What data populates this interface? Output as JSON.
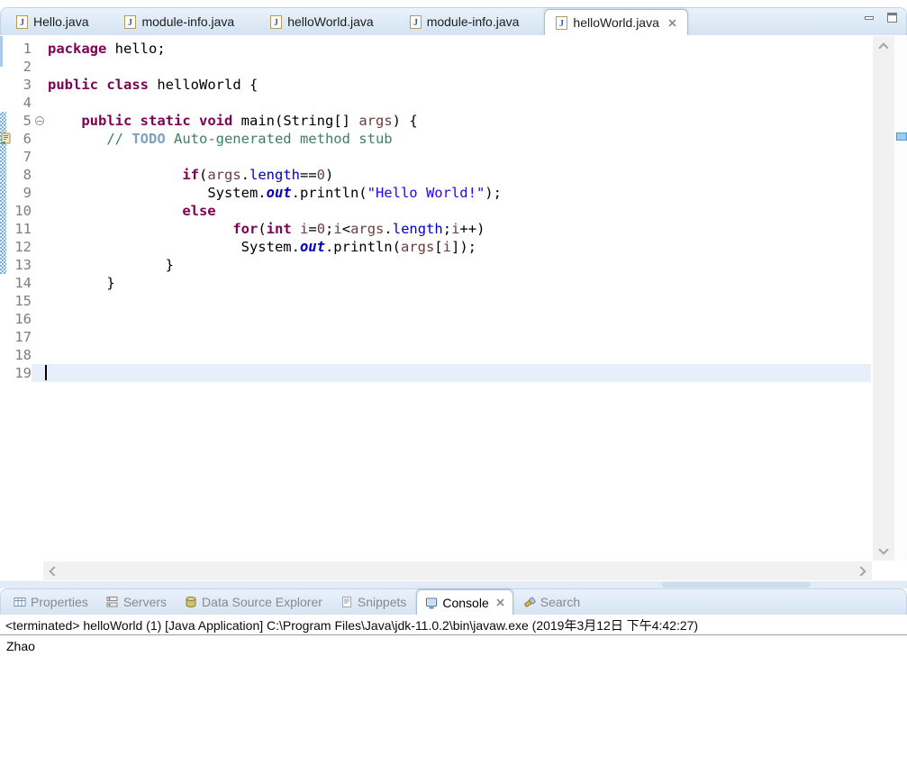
{
  "colors": {
    "keyword": "#7F0055",
    "string": "#2A00FF",
    "comment": "#3F7F5F",
    "task_tag": "#7F9FBF",
    "field": "#0000C0",
    "static_field": "#0000C0",
    "variable": "#6A3E3E",
    "line_number": "#7E7E7E",
    "current_line_bg": "#E7F0FA",
    "tab_bar_bg": "#D9E7F5"
  },
  "editor_tabs": [
    {
      "label": "Hello.java",
      "icon": "java-file",
      "active": false
    },
    {
      "label": "module-info.java",
      "icon": "java-file",
      "active": false
    },
    {
      "label": "helloWorld.java",
      "icon": "java-file",
      "active": false
    },
    {
      "label": "module-info.java",
      "icon": "java-file",
      "active": false
    },
    {
      "label": "helloWorld.java",
      "icon": "java-file",
      "active": true,
      "closable": true
    }
  ],
  "code": {
    "lines": [
      {
        "n": 1,
        "seg": [
          [
            "kw",
            "package"
          ],
          [
            "pl",
            " hello;"
          ]
        ]
      },
      {
        "n": 2,
        "seg": []
      },
      {
        "n": 3,
        "seg": [
          [
            "kw",
            "public"
          ],
          [
            "pl",
            " "
          ],
          [
            "kw",
            "class"
          ],
          [
            "pl",
            " helloWorld {"
          ]
        ]
      },
      {
        "n": 4,
        "seg": []
      },
      {
        "n": 5,
        "diff": true,
        "fold": "collapse",
        "seg": [
          [
            "pl",
            "    "
          ],
          [
            "kw",
            "public"
          ],
          [
            "pl",
            " "
          ],
          [
            "kw",
            "static"
          ],
          [
            "pl",
            " "
          ],
          [
            "kw",
            "void"
          ],
          [
            "pl",
            " main(String[] "
          ],
          [
            "var",
            "args"
          ],
          [
            "pl",
            ") {"
          ]
        ]
      },
      {
        "n": 6,
        "diff": true,
        "task": true,
        "seg": [
          [
            "pl",
            "       "
          ],
          [
            "cm",
            "// "
          ],
          [
            "todo",
            "TODO"
          ],
          [
            "cm",
            " Auto-generated method stub"
          ]
        ]
      },
      {
        "n": 7,
        "diff": true,
        "seg": []
      },
      {
        "n": 8,
        "diff": true,
        "seg": [
          [
            "pl",
            "                "
          ],
          [
            "kw",
            "if"
          ],
          [
            "pl",
            "("
          ],
          [
            "var",
            "args"
          ],
          [
            "pl",
            "."
          ],
          [
            "fld",
            "length"
          ],
          [
            "pl",
            "=="
          ],
          [
            "num",
            "0"
          ],
          [
            "pl",
            ")"
          ]
        ]
      },
      {
        "n": 9,
        "diff": true,
        "seg": [
          [
            "pl",
            "                   "
          ],
          [
            "pl",
            "System."
          ],
          [
            "sfld",
            "out"
          ],
          [
            "pl",
            ".println("
          ],
          [
            "str",
            "\"Hello World!\""
          ],
          [
            "pl",
            ");"
          ]
        ]
      },
      {
        "n": 10,
        "diff": true,
        "seg": [
          [
            "pl",
            "                "
          ],
          [
            "kw",
            "else"
          ]
        ]
      },
      {
        "n": 11,
        "diff": true,
        "seg": [
          [
            "pl",
            "                      "
          ],
          [
            "kw",
            "for"
          ],
          [
            "pl",
            "("
          ],
          [
            "kw",
            "int"
          ],
          [
            "pl",
            " "
          ],
          [
            "var",
            "i"
          ],
          [
            "pl",
            "="
          ],
          [
            "num",
            "0"
          ],
          [
            "pl",
            ";"
          ],
          [
            "var",
            "i"
          ],
          [
            "pl",
            "<"
          ],
          [
            "var",
            "args"
          ],
          [
            "pl",
            "."
          ],
          [
            "fld",
            "length"
          ],
          [
            "pl",
            ";"
          ],
          [
            "var",
            "i"
          ],
          [
            "pl",
            "++)"
          ]
        ]
      },
      {
        "n": 12,
        "diff": true,
        "seg": [
          [
            "pl",
            "                       "
          ],
          [
            "pl",
            "System."
          ],
          [
            "sfld",
            "out"
          ],
          [
            "pl",
            ".println("
          ],
          [
            "var",
            "args"
          ],
          [
            "pl",
            "["
          ],
          [
            "var",
            "i"
          ],
          [
            "pl",
            "]);"
          ]
        ]
      },
      {
        "n": 13,
        "diff": true,
        "seg": [
          [
            "pl",
            "              "
          ],
          [
            "pl",
            "}"
          ]
        ]
      },
      {
        "n": 14,
        "seg": [
          [
            "pl",
            "       "
          ],
          [
            "pl",
            "}"
          ]
        ]
      },
      {
        "n": 15,
        "seg": []
      },
      {
        "n": 16,
        "seg": []
      },
      {
        "n": 17,
        "seg": []
      },
      {
        "n": 18,
        "seg": []
      },
      {
        "n": 19,
        "seg": [],
        "current": true
      }
    ]
  },
  "console_tabs": [
    {
      "label": "Properties",
      "icon": "properties",
      "active": false
    },
    {
      "label": "Servers",
      "icon": "servers",
      "active": false
    },
    {
      "label": "Data Source Explorer",
      "icon": "database",
      "active": false
    },
    {
      "label": "Snippets",
      "icon": "snippets",
      "active": false
    },
    {
      "label": "Console",
      "icon": "console",
      "active": true,
      "closable": true
    },
    {
      "label": "Search",
      "icon": "search",
      "active": false
    }
  ],
  "console": {
    "header": "<terminated> helloWorld (1) [Java Application] C:\\Program Files\\Java\\jdk-11.0.2\\bin\\javaw.exe (2019年3月12日 下午4:42:27)",
    "output": "Zhao"
  }
}
